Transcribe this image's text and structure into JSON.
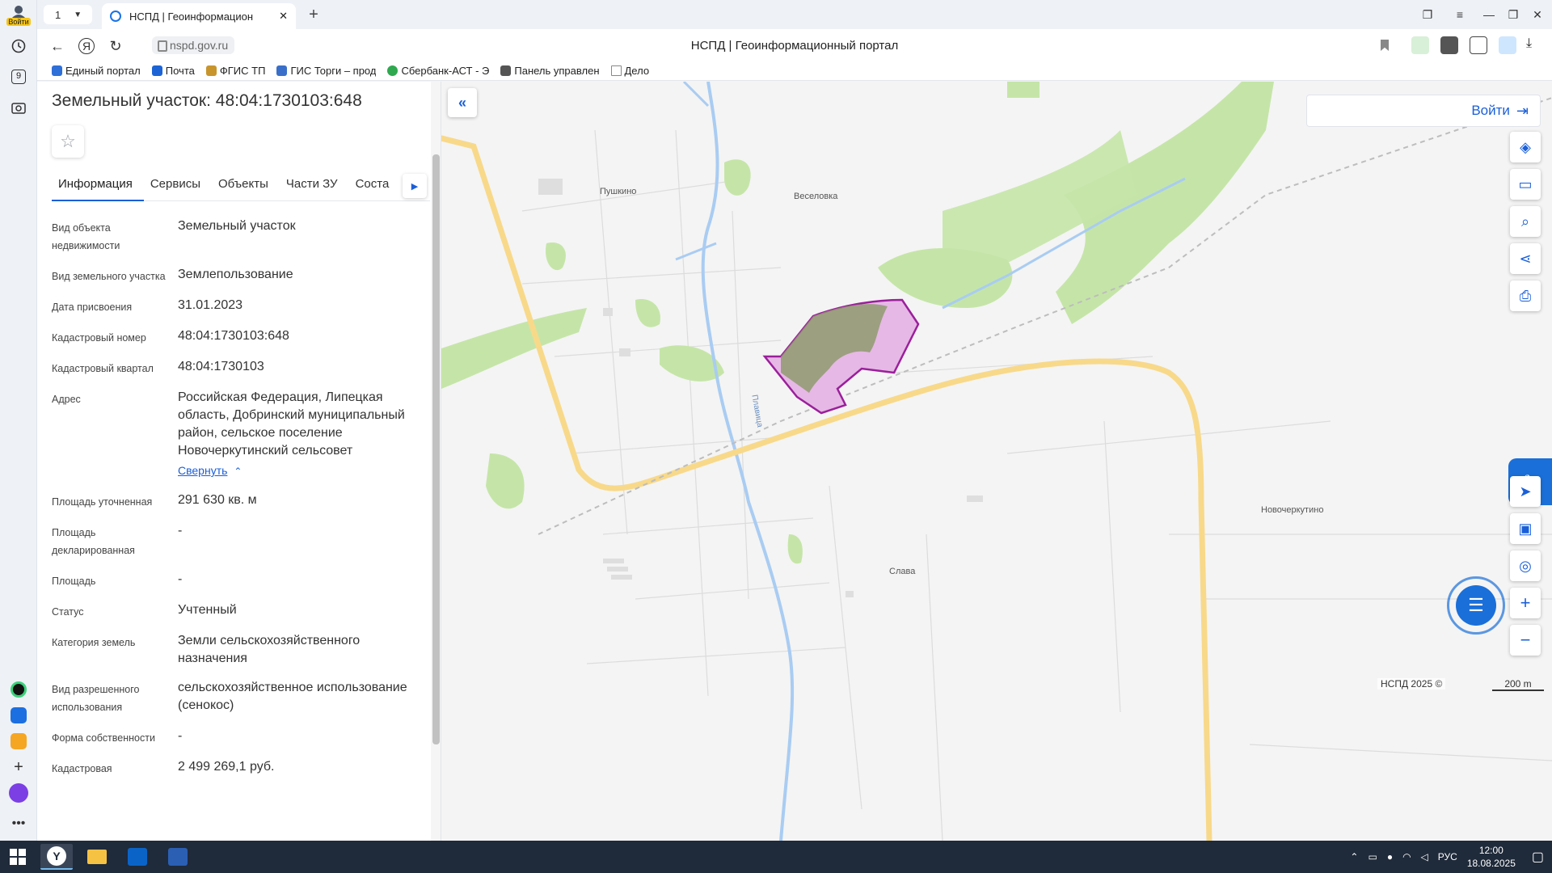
{
  "browser": {
    "profile_label": "Войти",
    "tab_count": "1",
    "active_tab_title": "НСПД | Геоинформацион",
    "url": "nspd.gov.ru",
    "page_title": "НСПД | Геоинформационный портал",
    "rail_badge": "9",
    "bookmarks": [
      {
        "label": "Единый портал",
        "color": "#2f6fd8"
      },
      {
        "label": "Почта",
        "color": "#1c64d6"
      },
      {
        "label": "ФГИС ТП",
        "color": "#c8952d"
      },
      {
        "label": "ГИС Торги – прод",
        "color": "#3a6fc9"
      },
      {
        "label": "Сбербанк-АСТ - Э",
        "color": "#2fa84f"
      },
      {
        "label": "Панель управлен",
        "color": "#555555"
      },
      {
        "label": "Дело",
        "color": "#888888"
      }
    ]
  },
  "panel": {
    "title": "Земельный участок: 48:04:1730103:648",
    "tabs": [
      "Информация",
      "Сервисы",
      "Объекты",
      "Части ЗУ",
      "Соста"
    ],
    "collapse_label": "Свернуть",
    "properties": [
      {
        "label": "Вид объекта недвижимости",
        "value": "Земельный участок"
      },
      {
        "label": "Вид земельного участка",
        "value": "Землепользование"
      },
      {
        "label": "Дата присвоения",
        "value": "31.01.2023"
      },
      {
        "label": "Кадастровый номер",
        "value": "48:04:1730103:648"
      },
      {
        "label": "Кадастровый квартал",
        "value": "48:04:1730103"
      },
      {
        "label": "Адрес",
        "value": "Российская Федерация, Липецкая область, Добринский муниципальный район, сельское поселение Новочеркутинский сельсовет"
      },
      {
        "label": "Площадь уточненная",
        "value": "291 630 кв. м"
      },
      {
        "label": "Площадь декларированная",
        "value": "-"
      },
      {
        "label": "Площадь",
        "value": "-"
      },
      {
        "label": "Статус",
        "value": "Учтенный"
      },
      {
        "label": "Категория земель",
        "value": "Земли сельскохозяйственного назначения"
      },
      {
        "label": "Вид разрешенного использования",
        "value": "сельскохозяйственное использование (сенокос)"
      },
      {
        "label": "Форма собственности",
        "value": "-"
      },
      {
        "label": "Кадастровая",
        "value": "2 499 269,1 руб."
      }
    ]
  },
  "map": {
    "login_label": "Войти",
    "places": [
      "Пушкино",
      "Веселовка",
      "Новочеркутино",
      "Слава"
    ],
    "river_label": "Плавица",
    "attribution": "НСПД 2025 ©",
    "scale_label": "200 m",
    "colors": {
      "road": "#f8d98a",
      "green": "#c5e5a8",
      "river": "#a9ccf2",
      "parcel_stroke": "#9b1f9b",
      "parcel_fill": "#e6b8e6"
    }
  },
  "taskbar": {
    "language": "РУС",
    "time": "12:00",
    "date": "18.08.2025"
  }
}
